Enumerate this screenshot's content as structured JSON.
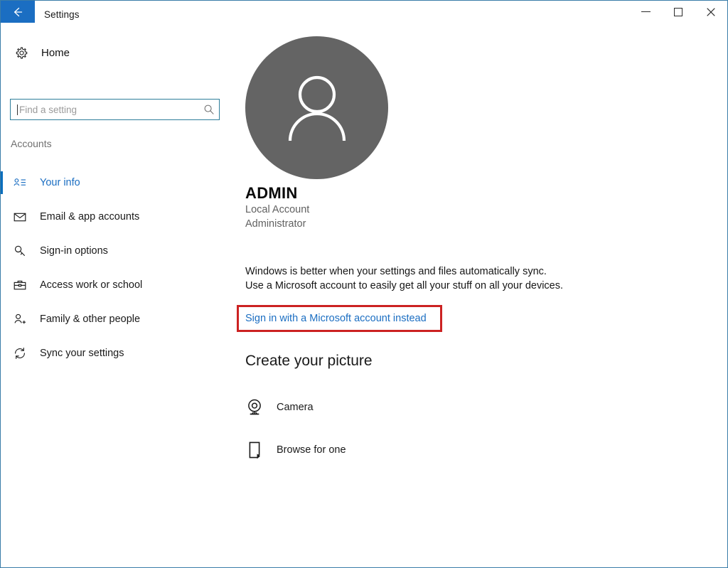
{
  "window": {
    "title": "Settings",
    "back_icon": "back-arrow-icon",
    "minimize_label": "Minimize",
    "maximize_label": "Maximize",
    "close_label": "Close",
    "accent_color": "#1b6ec2",
    "border_color": "#3a7ca8"
  },
  "sidebar": {
    "home": {
      "label": "Home",
      "icon": "gear-icon"
    },
    "search": {
      "value": "",
      "placeholder": "Find a setting",
      "icon": "search-icon"
    },
    "section_header": "Accounts",
    "items": [
      {
        "label": "Your info",
        "icon": "contact-card-icon",
        "selected": true
      },
      {
        "label": "Email & app accounts",
        "icon": "envelope-icon",
        "selected": false
      },
      {
        "label": "Sign-in options",
        "icon": "key-icon",
        "selected": false
      },
      {
        "label": "Access work or school",
        "icon": "briefcase-icon",
        "selected": false
      },
      {
        "label": "Family & other people",
        "icon": "person-add-icon",
        "selected": false
      },
      {
        "label": "Sync your settings",
        "icon": "sync-icon",
        "selected": false
      }
    ]
  },
  "main": {
    "avatar": {
      "icon": "person-avatar-icon",
      "background_color": "#646464"
    },
    "account_name": "ADMIN",
    "account_type": "Local Account",
    "account_role": "Administrator",
    "sync_description": "Windows is better when your settings and files automatically sync. Use a Microsoft account to easily get all your stuff on all your devices.",
    "signin_link": "Sign in with a Microsoft account instead",
    "highlight_color": "#cc2222",
    "create_picture": {
      "title": "Create your picture",
      "options": [
        {
          "label": "Camera",
          "icon": "webcam-icon"
        },
        {
          "label": "Browse for one",
          "icon": "document-browse-icon"
        }
      ]
    }
  }
}
